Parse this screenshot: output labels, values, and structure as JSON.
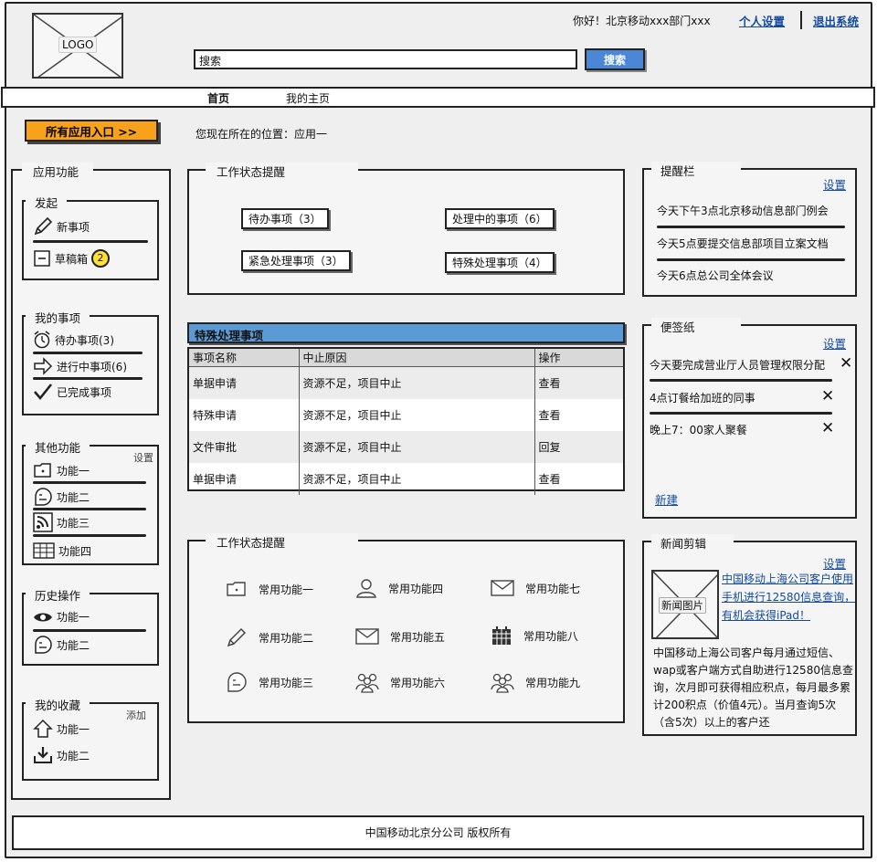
{
  "header": {
    "logo_text": "LOGO",
    "greeting": "你好！北京移动xxx部门xxx",
    "personal_settings": "个人设置",
    "logout": "退出系统",
    "search_value": "搜索",
    "search_button": "搜索"
  },
  "nav": {
    "items": [
      {
        "label": "首页",
        "active": true
      },
      {
        "label": "我的主页",
        "active": false
      }
    ]
  },
  "top": {
    "apps_button": "所有应用入口 >>",
    "location": "您现在所在的位置：应用一"
  },
  "sidebar": {
    "title": "应用功能",
    "launch": {
      "title": "发起",
      "items": [
        {
          "label": "新事项",
          "icon": "pencil-icon"
        },
        {
          "label": "草稿箱",
          "icon": "minus-box-icon",
          "badge": "2"
        }
      ]
    },
    "my_items": {
      "title": "我的事项",
      "items": [
        {
          "label": "待办事项(3)",
          "icon": "alarm-clock-icon"
        },
        {
          "label": "进行中事项(6)",
          "icon": "arrow-right-icon"
        },
        {
          "label": "已完成事项",
          "icon": "check-icon"
        }
      ]
    },
    "other": {
      "title": "其他功能",
      "settings": "设置",
      "items": [
        {
          "label": "功能一",
          "icon": "folder-icon"
        },
        {
          "label": "功能二",
          "icon": "chat-face-icon"
        },
        {
          "label": "功能三",
          "icon": "rss-icon"
        },
        {
          "label": "功能四",
          "icon": "grid-icon"
        }
      ]
    },
    "history": {
      "title": "历史操作",
      "items": [
        {
          "label": "功能一",
          "icon": "eye-icon"
        },
        {
          "label": "功能二",
          "icon": "chat-face-icon"
        }
      ]
    },
    "favorites": {
      "title": "我的收藏",
      "add": "添加",
      "items": [
        {
          "label": "功能一",
          "icon": "home-icon"
        },
        {
          "label": "功能二",
          "icon": "download-icon"
        }
      ]
    }
  },
  "work_status": {
    "title": "工作状态提醒",
    "items": [
      "待办事项（3）",
      "处理中的事项（6）",
      "紧急处理事项（3）",
      "特殊处理事项（4）"
    ]
  },
  "special_table": {
    "title": "特殊处理事项",
    "columns": [
      "事项名称",
      "中止原因",
      "操作"
    ],
    "rows": [
      [
        "单据申请",
        "资源不足，项目中止",
        "查看"
      ],
      [
        "特殊申请",
        "资源不足，项目中止",
        "查看"
      ],
      [
        "文件审批",
        "资源不足，项目中止",
        "回复"
      ],
      [
        "单据申请",
        "资源不足，项目中止",
        "查看"
      ]
    ]
  },
  "common_functions": {
    "title": "工作状态提醒",
    "items": [
      {
        "label": "常用功能一",
        "icon": "folder-icon"
      },
      {
        "label": "常用功能四",
        "icon": "user-icon"
      },
      {
        "label": "常用功能七",
        "icon": "mail-icon"
      },
      {
        "label": "常用功能二",
        "icon": "pencil-icon"
      },
      {
        "label": "常用功能五",
        "icon": "mail-icon"
      },
      {
        "label": "常用功能八",
        "icon": "calendar-icon"
      },
      {
        "label": "常用功能三",
        "icon": "chat-face-icon"
      },
      {
        "label": "常用功能六",
        "icon": "group-icon"
      },
      {
        "label": "常用功能九",
        "icon": "group-icon"
      }
    ]
  },
  "reminders": {
    "title": "提醒栏",
    "settings": "设置",
    "items": [
      "今天下午3点北京移动信息部门例会",
      "今天5点要提交信息部项目立案文档",
      "今天6点总公司全体会议"
    ]
  },
  "notes": {
    "title": "便签纸",
    "settings": "设置",
    "items": [
      "今天要完成营业厅人员管理权限分配",
      "4点订餐给加班的同事",
      "晚上7：00家人聚餐"
    ],
    "new_label": "新建"
  },
  "news": {
    "title": "新闻剪辑",
    "settings": "设置",
    "image_label": "新闻图片",
    "headline": "中国移动上海公司客户使用手机进行12580信息查询，有机会获得iPad！",
    "body": "中国移动上海公司客户每月通过短信、wap或客户端方式自助进行12580信息查询，次月即可获得相应积点，每月最多累计200积点（价值4元）。当月查询5次（含5次）以上的客户还"
  },
  "footer": {
    "text": "中国移动北京分公司 版权所有"
  }
}
